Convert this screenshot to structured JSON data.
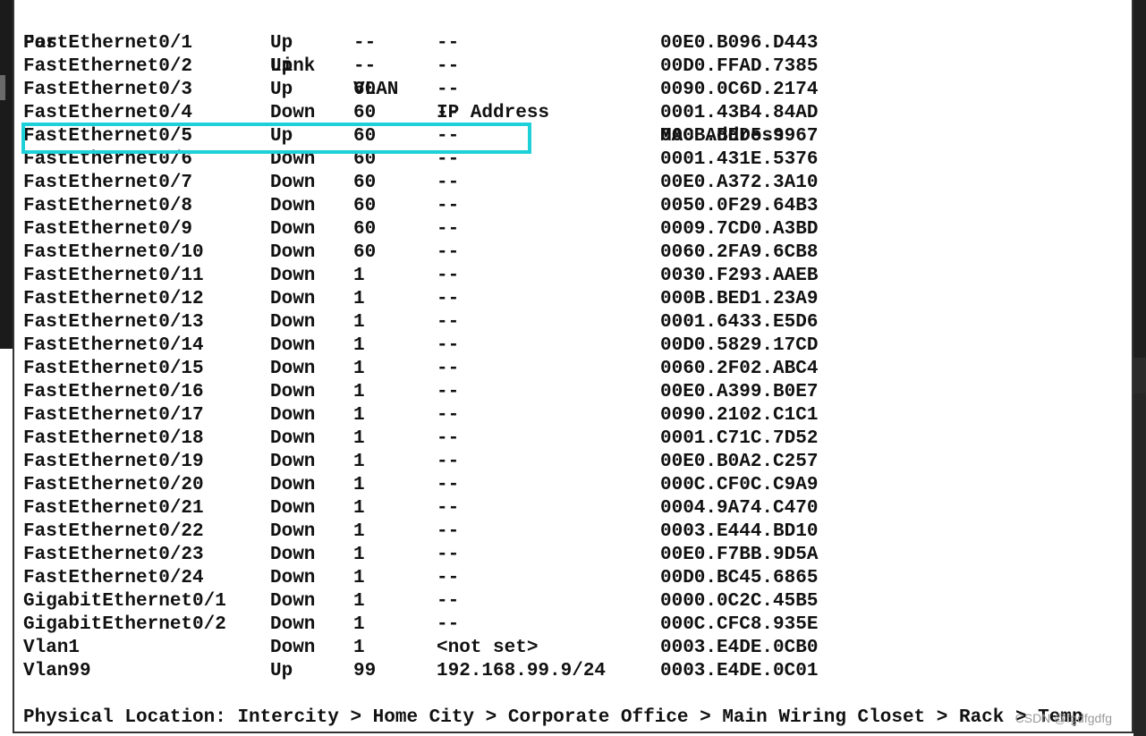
{
  "table": {
    "headers": {
      "port": "Port",
      "link": "Link",
      "vlan": "VLAN",
      "ip": "IP Address",
      "mac": "MAC Address"
    },
    "rows": [
      {
        "port": "FastEthernet0/1",
        "link": "Up",
        "vlan": "--",
        "ip": "--",
        "mac": "00E0.B096.D443"
      },
      {
        "port": "FastEthernet0/2",
        "link": "Up",
        "vlan": "--",
        "ip": "--",
        "mac": "00D0.FFAD.7385"
      },
      {
        "port": "FastEthernet0/3",
        "link": "Up",
        "vlan": "60",
        "ip": "--",
        "mac": "0090.0C6D.2174"
      },
      {
        "port": "FastEthernet0/4",
        "link": "Down",
        "vlan": "60",
        "ip": "--",
        "mac": "0001.43B4.84AD"
      },
      {
        "port": "FastEthernet0/5",
        "link": "Up",
        "vlan": "60",
        "ip": "--",
        "mac": "000B.BED5.9967"
      },
      {
        "port": "FastEthernet0/6",
        "link": "Down",
        "vlan": "60",
        "ip": "--",
        "mac": "0001.431E.5376"
      },
      {
        "port": "FastEthernet0/7",
        "link": "Down",
        "vlan": "60",
        "ip": "--",
        "mac": "00E0.A372.3A10"
      },
      {
        "port": "FastEthernet0/8",
        "link": "Down",
        "vlan": "60",
        "ip": "--",
        "mac": "0050.0F29.64B3"
      },
      {
        "port": "FastEthernet0/9",
        "link": "Down",
        "vlan": "60",
        "ip": "--",
        "mac": "0009.7CD0.A3BD"
      },
      {
        "port": "FastEthernet0/10",
        "link": "Down",
        "vlan": "60",
        "ip": "--",
        "mac": "0060.2FA9.6CB8"
      },
      {
        "port": "FastEthernet0/11",
        "link": "Down",
        "vlan": "1",
        "ip": "--",
        "mac": "0030.F293.AAEB"
      },
      {
        "port": "FastEthernet0/12",
        "link": "Down",
        "vlan": "1",
        "ip": "--",
        "mac": "000B.BED1.23A9"
      },
      {
        "port": "FastEthernet0/13",
        "link": "Down",
        "vlan": "1",
        "ip": "--",
        "mac": "0001.6433.E5D6"
      },
      {
        "port": "FastEthernet0/14",
        "link": "Down",
        "vlan": "1",
        "ip": "--",
        "mac": "00D0.5829.17CD"
      },
      {
        "port": "FastEthernet0/15",
        "link": "Down",
        "vlan": "1",
        "ip": "--",
        "mac": "0060.2F02.ABC4"
      },
      {
        "port": "FastEthernet0/16",
        "link": "Down",
        "vlan": "1",
        "ip": "--",
        "mac": "00E0.A399.B0E7"
      },
      {
        "port": "FastEthernet0/17",
        "link": "Down",
        "vlan": "1",
        "ip": "--",
        "mac": "0090.2102.C1C1"
      },
      {
        "port": "FastEthernet0/18",
        "link": "Down",
        "vlan": "1",
        "ip": "--",
        "mac": "0001.C71C.7D52"
      },
      {
        "port": "FastEthernet0/19",
        "link": "Down",
        "vlan": "1",
        "ip": "--",
        "mac": "00E0.B0A2.C257"
      },
      {
        "port": "FastEthernet0/20",
        "link": "Down",
        "vlan": "1",
        "ip": "--",
        "mac": "000C.CF0C.C9A9"
      },
      {
        "port": "FastEthernet0/21",
        "link": "Down",
        "vlan": "1",
        "ip": "--",
        "mac": "0004.9A74.C470"
      },
      {
        "port": "FastEthernet0/22",
        "link": "Down",
        "vlan": "1",
        "ip": "--",
        "mac": "0003.E444.BD10"
      },
      {
        "port": "FastEthernet0/23",
        "link": "Down",
        "vlan": "1",
        "ip": "--",
        "mac": "00E0.F7BB.9D5A"
      },
      {
        "port": "FastEthernet0/24",
        "link": "Down",
        "vlan": "1",
        "ip": "--",
        "mac": "00D0.BC45.6865"
      },
      {
        "port": "GigabitEthernet0/1",
        "link": "Down",
        "vlan": "1",
        "ip": "--",
        "mac": "0000.0C2C.45B5"
      },
      {
        "port": "GigabitEthernet0/2",
        "link": "Down",
        "vlan": "1",
        "ip": "--",
        "mac": "000C.CFC8.935E"
      },
      {
        "port": "Vlan1",
        "link": "Down",
        "vlan": "1",
        "ip": "<not set>",
        "mac": "0003.E4DE.0CB0"
      },
      {
        "port": "Vlan99",
        "link": "Up",
        "vlan": "99",
        "ip": "192.168.99.9/24",
        "mac": "0003.E4DE.0C01"
      }
    ]
  },
  "location": "Physical Location: Intercity > Home City > Corporate Office > Main Wiring Closet > Rack > Temp",
  "highlight": {
    "row_port": "FastEthernet0/5",
    "color": "#1ed0d8"
  },
  "watermark": "CSDN @fgdfgdfg"
}
